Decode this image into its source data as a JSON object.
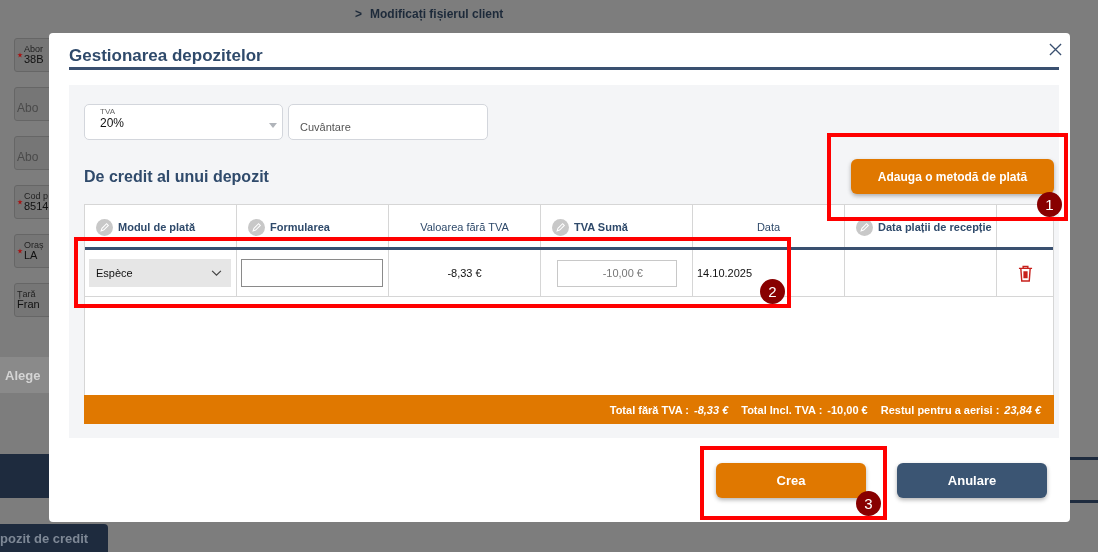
{
  "background": {
    "breadcrumb": {
      "arrow": ">",
      "label": "Modificați fișierul client"
    },
    "fields": [
      {
        "label": "Abor",
        "value": "38B",
        "required": true
      },
      {
        "placeholder": "Abo",
        "required": false
      },
      {
        "placeholder": "Abo",
        "required": false
      },
      {
        "label": "Cod p",
        "value": "8514",
        "required": true
      },
      {
        "label": "Oraș",
        "value": "LA",
        "required": true
      },
      {
        "label": "Țară",
        "value": "Fran",
        "required": false
      }
    ],
    "button": "Alege",
    "tab": "pozit de credit"
  },
  "dialog": {
    "title": "Gestionarea depozitelor",
    "tva": {
      "label": "TVA",
      "value": "20%"
    },
    "comment": {
      "placeholder": "Cuvântare"
    },
    "section_title": "De credit al unui depozit",
    "add_button": "Adauga o metodă de plată",
    "table": {
      "columns": [
        {
          "label": "Modul de plată",
          "editable": true
        },
        {
          "label": "Formularea",
          "editable": true
        },
        {
          "label": "Valoarea fără TVA",
          "editable": false
        },
        {
          "label": "TVA Sumă",
          "editable": true
        },
        {
          "label": "Data",
          "editable": false
        },
        {
          "label": "Data plații de recepție",
          "editable": true
        }
      ],
      "rows": [
        {
          "payment_mode": "Espèce",
          "value_excl": "-8,33 €",
          "tva_amount": "-10,00 €",
          "date": "14.10.2025"
        }
      ]
    },
    "totals": [
      {
        "label": "Total fără TVA :",
        "value": "-8,33 €",
        "italic": true
      },
      {
        "label": "Total Incl. TVA :",
        "value": "-10,00 €",
        "italic": false
      },
      {
        "label": "Restul pentru a aerisi :",
        "value": "23,84 €",
        "italic": true
      }
    ],
    "buttons": [
      {
        "label": "Crea",
        "kind": "primary"
      },
      {
        "label": "Anulare",
        "kind": "secondary"
      }
    ]
  },
  "annotations": [
    {
      "label": "1"
    },
    {
      "label": "2"
    },
    {
      "label": "3"
    }
  ]
}
